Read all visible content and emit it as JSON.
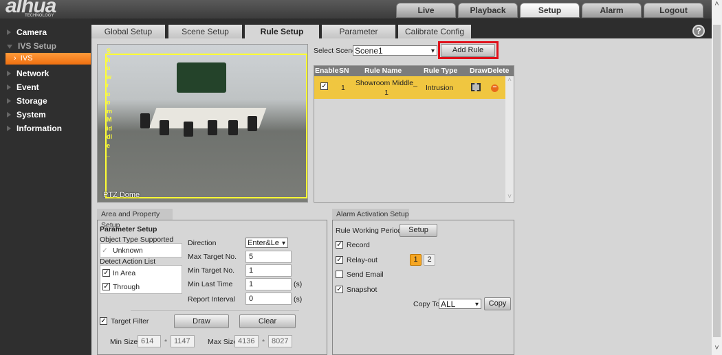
{
  "brand": {
    "logo": "alhua",
    "sub": "TECHNOLOGY"
  },
  "topnav": [
    "Live",
    "Playback",
    "Setup",
    "Alarm",
    "Logout"
  ],
  "topnav_active": "Setup",
  "sidebar": {
    "items": [
      {
        "label": "Camera"
      },
      {
        "label": "IVS Setup",
        "open": true
      },
      {
        "label": "IVS",
        "selected": true
      },
      {
        "label": "Network"
      },
      {
        "label": "Event"
      },
      {
        "label": "Storage"
      },
      {
        "label": "System"
      },
      {
        "label": "Information"
      }
    ]
  },
  "tabs": [
    {
      "label": "Global Setup"
    },
    {
      "label": "Scene Setup"
    },
    {
      "label": "Rule Setup",
      "active": true
    },
    {
      "label": "Parameter"
    },
    {
      "label": "Calibrate Config"
    }
  ],
  "video": {
    "rule_label": "Showroom Middle_",
    "osd_channel": "PTZ Dome"
  },
  "scene": {
    "label": "Select Scene",
    "value": "Scene1",
    "add_rule": "Add Rule"
  },
  "rules": {
    "headers": [
      "Enable",
      "SN",
      "Rule Name",
      "Rule Type",
      "Draw",
      "Delete"
    ],
    "rows": [
      {
        "enabled": true,
        "sn": "1",
        "name_1": "Showroom Middle_",
        "name_2": "1",
        "type": "Intrusion"
      }
    ]
  },
  "area": {
    "tab": "Area and Property Setup",
    "title": "Parameter Setup",
    "object_type_label": "Object Type Supported",
    "object_type": "Unknown",
    "detect_label": "Detect Action List",
    "detect_actions": [
      {
        "label": "In Area",
        "checked": true
      },
      {
        "label": "Through",
        "checked": true
      }
    ],
    "direction_label": "Direction",
    "direction": "Enter&Le",
    "max_target_label": "Max Target No.",
    "max_target": "5",
    "min_target_label": "Min Target No.",
    "min_target": "1",
    "min_last_label": "Min Last Time",
    "min_last": "1",
    "report_label": "Report Interval",
    "report": "0",
    "unit": "(s)",
    "target_filter": "Target Filter",
    "draw": "Draw",
    "clear": "Clear",
    "min_size_label": "Min Size",
    "min_w": "614",
    "min_h": "1147",
    "max_size_label": "Max Size",
    "max_w": "4136",
    "max_h": "8027",
    "times": "*"
  },
  "alarm": {
    "tab": "Alarm Activation Setup",
    "period_label": "Rule Working Period",
    "setup": "Setup",
    "record": "Record",
    "relay": "Relay-out",
    "relay_1": "1",
    "relay_2": "2",
    "email": "Send Email",
    "snapshot": "Snapshot",
    "copy_to_label": "Copy To",
    "copy_to": "ALL",
    "copy": "Copy"
  },
  "colors": {
    "accent": "#f08a20",
    "row_highlight": "#f0c640",
    "zone": "#ffff33",
    "highlight_box": "#e0101a"
  }
}
